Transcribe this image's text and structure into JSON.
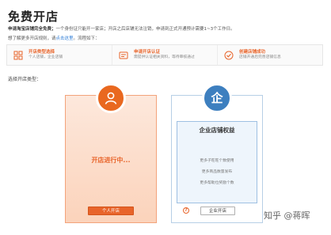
{
  "page": {
    "title": "免费开店",
    "notice_bold": "申请淘宝店铺完全免费；",
    "notice_rest": "一个身份证只能开一家店；开店之后店铺无法注销，申请到正式开通预计需要1~3个工作日。",
    "info_prefix": "想了解更多开店规则，请",
    "info_link": "点击这里",
    "info_suffix": "。流程如下："
  },
  "steps": [
    {
      "icon": "store-type-icon",
      "title": "开店类型选择",
      "desc": "个人店铺，企业店铺"
    },
    {
      "icon": "certification-icon",
      "title": "申请开店认证",
      "desc": "需提供认证相关资料，等待审核通过"
    },
    {
      "icon": "check-circle-icon",
      "title": "创建店铺成功",
      "desc": "店铺开通后完善店铺信息"
    }
  ],
  "section_label": "选择开店类型：",
  "personal": {
    "icon": "person-icon",
    "heading": "开店进行中...",
    "button": "个人开店"
  },
  "enterprise": {
    "icon": "enterprise-icon",
    "badge_text": "企",
    "heading": "企业店铺权益",
    "benefits": [
      "更多子旺旺个数使用",
      "更多商品数量发布",
      "更多帮助位奖励个数"
    ],
    "help": "?",
    "button": "企业开店"
  },
  "watermark": "知乎 @蒋晖",
  "colors": {
    "accent_orange": "#e8642a",
    "accent_blue": "#3d7fbf"
  }
}
